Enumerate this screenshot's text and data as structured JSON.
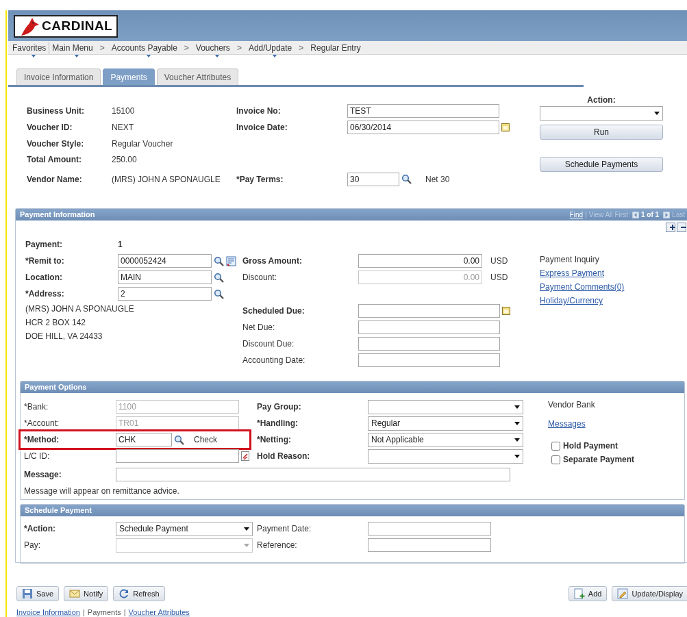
{
  "logo": {
    "text": "CARDINAL"
  },
  "breadcrumb": [
    {
      "label": "Favorites",
      "menu": true
    },
    {
      "label": "Main Menu",
      "menu": true
    },
    {
      "separator": ">",
      "label": "Accounts Payable",
      "menu": true
    },
    {
      "separator": ">",
      "label": "Vouchers",
      "menu": true
    },
    {
      "separator": ">",
      "label": "Add/Update",
      "menu": true
    },
    {
      "separator": ">",
      "label": "Regular Entry",
      "menu": false
    }
  ],
  "tabs": [
    {
      "label": "Invoice Information",
      "selected": false
    },
    {
      "label": "Payments",
      "selected": true
    },
    {
      "label": "Voucher Attributes",
      "selected": false
    }
  ],
  "summary": {
    "rows": [
      {
        "label": "Business Unit:",
        "value": "15100",
        "field": {
          "label": "Invoice No:",
          "kind": "text",
          "value": "TEST"
        }
      },
      {
        "label": "Voucher ID:",
        "value": "NEXT",
        "field": {
          "label": "Invoice Date:",
          "kind": "date",
          "value": "06/30/2014"
        }
      },
      {
        "label": "Voucher Style:",
        "value": "Regular Voucher"
      },
      {
        "label": "Total Amount:",
        "value": "250.00"
      },
      {
        "label": "Vendor Name:",
        "value": "(MRS) JOHN A SPONAUGLE",
        "field": {
          "label": "*Pay Terms:",
          "kind": "lookup",
          "value": "30",
          "description": "Net 30"
        }
      }
    ],
    "action": {
      "label": "Action:",
      "buttons": [
        "Run",
        "Schedule Payments"
      ]
    }
  },
  "payment_information": {
    "title": "Payment Information",
    "nav": [
      {
        "kind": "link",
        "label": "Find"
      },
      {
        "kind": "separator",
        "label": "|"
      },
      {
        "kind": "disabled",
        "label": "View All"
      },
      {
        "kind": "disabled",
        "label": "First"
      },
      {
        "kind": "prev"
      },
      {
        "kind": "current",
        "label": "1 of 1"
      },
      {
        "kind": "next"
      },
      {
        "kind": "disabled",
        "label": "Last"
      }
    ],
    "left": [
      {
        "kind": "static",
        "label": "Payment:",
        "bold": true,
        "value": "1"
      },
      {
        "kind": "lookup_detail",
        "label": "*Remit to:",
        "bold": true,
        "value": "0000052424",
        "disabled": false
      },
      {
        "kind": "lookup",
        "label": "Location:",
        "bold": true,
        "value": "MAIN",
        "disabled": false
      },
      {
        "kind": "lookup",
        "label": "*Address:",
        "bold": true,
        "value": "2",
        "disabled": false
      },
      {
        "kind": "note",
        "text": "(MRS) JOHN A SPONAUGLE"
      },
      {
        "kind": "note",
        "text": "HCR 2 BOX 142"
      },
      {
        "kind": "note",
        "text": "DOE HILL, VA  24433"
      }
    ],
    "middle": [
      [
        {
          "kind": "amount",
          "label": "Gross Amount:",
          "bold": true,
          "value": "0.00",
          "disabled": false,
          "suffix": "USD"
        },
        {
          "kind": "amount",
          "label": "Discount:",
          "bold": false,
          "value": "0.00",
          "disabled": true,
          "suffix": "USD"
        }
      ],
      [
        {
          "kind": "date",
          "label": "Scheduled Due:",
          "bold": true,
          "disabled": false
        },
        {
          "kind": "text",
          "label": "Net Due:",
          "bold": false,
          "disabled": false
        },
        {
          "kind": "text",
          "label": "Discount Due:",
          "bold": false,
          "disabled": false
        },
        {
          "kind": "text",
          "label": "Accounting Date:",
          "bold": false,
          "disabled": false
        }
      ]
    ],
    "right": [
      {
        "kind": "note",
        "text": "Payment Inquiry"
      },
      {
        "kind": "link",
        "text": "Express Payment"
      },
      {
        "kind": "link",
        "text": "Payment Comments(0)"
      },
      {
        "kind": "link",
        "text": "Holiday/Currency"
      }
    ]
  },
  "payment_options": {
    "title": "Payment Options",
    "left": [
      {
        "kind": "text",
        "label": "*Bank:",
        "bold": false,
        "value": "1100",
        "disabled": true
      },
      {
        "kind": "text",
        "label": "*Account:",
        "bold": false,
        "value": "TR01",
        "disabled": true
      },
      {
        "kind": "lookup",
        "label": "*Method:",
        "bold": true,
        "value": "CHK",
        "disabled": false,
        "description": "Check",
        "highlighted": true
      },
      {
        "kind": "attach",
        "label": "L/C ID:",
        "bold": false,
        "disabled": false
      }
    ],
    "middle": [
      {
        "kind": "select",
        "label": "Pay Group:",
        "bold": true,
        "disabled": false
      },
      {
        "kind": "select",
        "label": "*Handling:",
        "bold": true,
        "value": "Regular",
        "disabled": false
      },
      {
        "kind": "select",
        "label": "*Netting:",
        "bold": true,
        "value": "Not Applicable",
        "disabled": false
      },
      {
        "kind": "select",
        "label": "Hold Reason:",
        "bold": true,
        "disabled": false
      }
    ],
    "right": [
      {
        "kind": "note",
        "text": "Vendor Bank"
      },
      {
        "kind": "link",
        "text": "Messages"
      },
      {
        "kind": "checkbox",
        "text": "Hold Payment",
        "checked": false
      },
      {
        "kind": "checkbox",
        "text": "Separate Payment",
        "checked": false
      }
    ],
    "message": {
      "label": "Message:",
      "bold": true
    },
    "note": "Message will appear on remittance advice."
  },
  "schedule_payment": {
    "title": "Schedule Payment",
    "rows": [
      {
        "left": {
          "kind": "select",
          "label": "*Action:",
          "bold": true,
          "value": "Schedule Payment",
          "disabled": false
        },
        "right": {
          "kind": "text",
          "label": "Payment Date:",
          "bold": false,
          "disabled": false
        }
      },
      {
        "left": {
          "kind": "select",
          "label": "Pay:",
          "bold": false,
          "disabled": true
        },
        "right": {
          "kind": "text",
          "label": "Reference:",
          "bold": false,
          "disabled": false
        }
      }
    ]
  },
  "toolbar": {
    "left": [
      {
        "kind": "save",
        "label": "Save"
      },
      {
        "kind": "notify",
        "label": "Notify"
      },
      {
        "kind": "refresh",
        "label": "Refresh"
      }
    ],
    "right": [
      {
        "kind": "add",
        "label": "Add"
      },
      {
        "kind": "update",
        "label": "Update/Display"
      }
    ]
  },
  "footer_links": [
    {
      "label": "Invoice Information",
      "link": true
    },
    {
      "separator": "|",
      "label": "Payments",
      "link": false
    },
    {
      "separator": "|",
      "label": "Voucher Attributes",
      "link": true
    }
  ]
}
